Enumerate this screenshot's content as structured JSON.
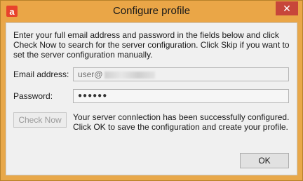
{
  "window": {
    "title": "Configure profile",
    "app_icon_letter": "a",
    "close_symbol": "✕"
  },
  "intro_text": "Enter your full email address and password in the fields below and click Check Now to search for the server configuration. Click Skip if you want to set the server configuration manually.",
  "email": {
    "label": "Email address:",
    "value": "user@"
  },
  "password": {
    "label": "Password:",
    "value": "●●●●●●"
  },
  "check_now_label": "Check Now",
  "status_text": "Your server connlection has been successfully configured. Click OK to save the configuration and create your profile.",
  "ok_label": "OK"
}
